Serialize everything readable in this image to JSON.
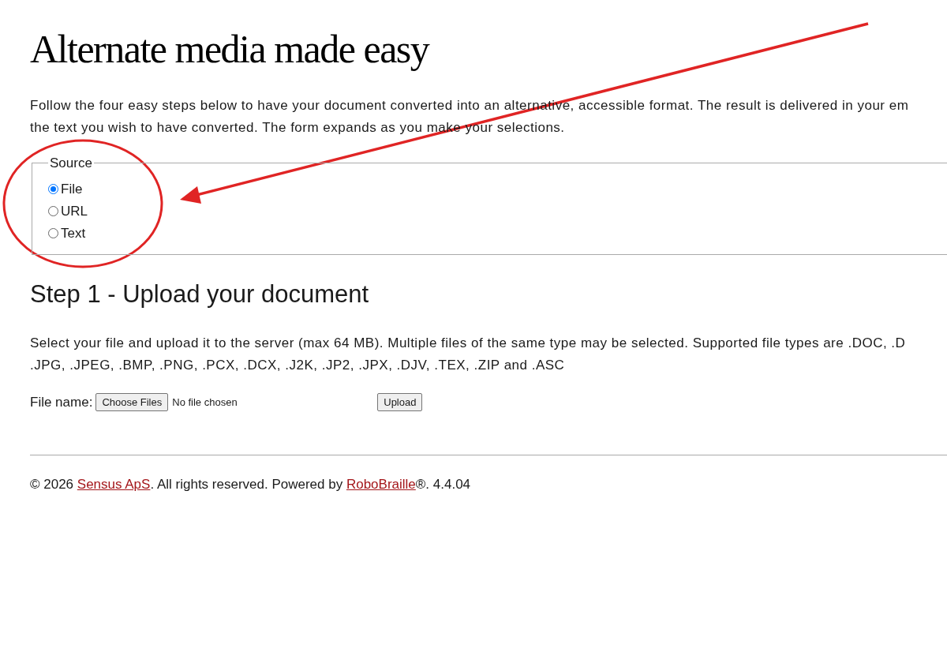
{
  "title": "Alternate media made easy",
  "intro_lines": [
    "Follow the four easy steps below to have your document converted into an alternative, accessible format. The result is delivered in your em",
    "the text you wish to have converted. The form expands as you make your selections."
  ],
  "source": {
    "legend": "Source",
    "options": [
      {
        "label": "File",
        "selected": true
      },
      {
        "label": "URL",
        "selected": false
      },
      {
        "label": "Text",
        "selected": false
      }
    ]
  },
  "step": {
    "heading": "Step 1 - Upload your document",
    "description_lines": [
      "Select your file and upload it to the server (max 64 MB). Multiple files of the same type may be selected. Supported file types are .DOC, .D",
      ".JPG, .JPEG, .BMP, .PNG, .PCX, .DCX, .J2K, .JP2, .JPX, .DJV, .TEX, .ZIP and .ASC"
    ],
    "file_label": "File name:",
    "choose_button": "Choose Files",
    "file_status": "No file chosen",
    "upload_button": "Upload"
  },
  "footer": [
    {
      "kind": "text",
      "text": "© 2026 "
    },
    {
      "kind": "link",
      "text": "Sensus ApS"
    },
    {
      "kind": "text",
      "text": ". All rights reserved. Powered by "
    },
    {
      "kind": "link",
      "text": "RoboBraille"
    },
    {
      "kind": "text",
      "text": "®. 4.4.04"
    }
  ]
}
